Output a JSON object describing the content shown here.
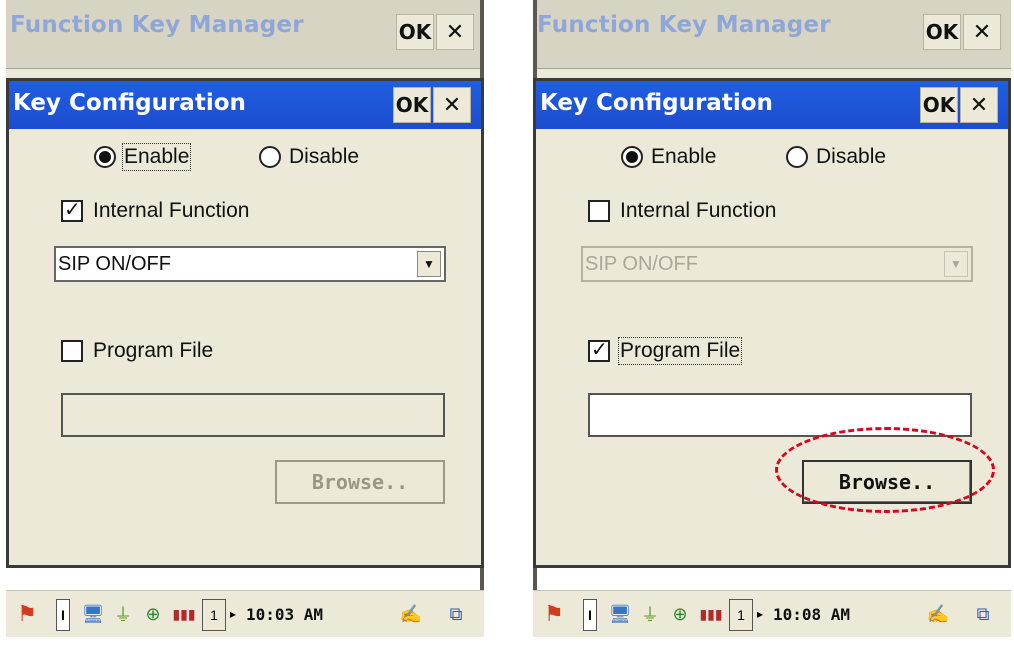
{
  "left": {
    "app_title": "Function Key Manager",
    "ok_label": "OK",
    "close_label": "✕",
    "dialog_title": "Key Configuration",
    "enable_label": "Enable",
    "disable_label": "Disable",
    "enable_selected": true,
    "internal_function_label": "Internal Function",
    "internal_function_checked": true,
    "function_select_value": "SIP ON/OFF",
    "program_file_label": "Program File",
    "program_file_checked": false,
    "program_file_value": "",
    "browse_label": "Browse..",
    "time": "10:03 AM",
    "input_num": "1"
  },
  "right": {
    "app_title": "Function Key Manager",
    "ok_label": "OK",
    "close_label": "✕",
    "dialog_title": "Key Configuration",
    "enable_label": "Enable",
    "disable_label": "Disable",
    "enable_selected": true,
    "internal_function_label": "Internal Function",
    "internal_function_checked": false,
    "function_select_value": "SIP ON/OFF",
    "program_file_label": "Program File",
    "program_file_checked": true,
    "program_file_value": "",
    "browse_label": "Browse..",
    "time": "10:08 AM",
    "input_num": "1"
  },
  "colors": {
    "title_bar": "#1f5fe0",
    "window_bg": "#ece9d8",
    "highlight": "#e0001c"
  },
  "icons": [
    "windows-start-icon",
    "input-indicator-icon",
    "network-icon",
    "power-plug-icon",
    "wireless-icon",
    "battery-icon",
    "input-mode-icon",
    "keyboard-sip-icon",
    "window-switch-icon"
  ]
}
